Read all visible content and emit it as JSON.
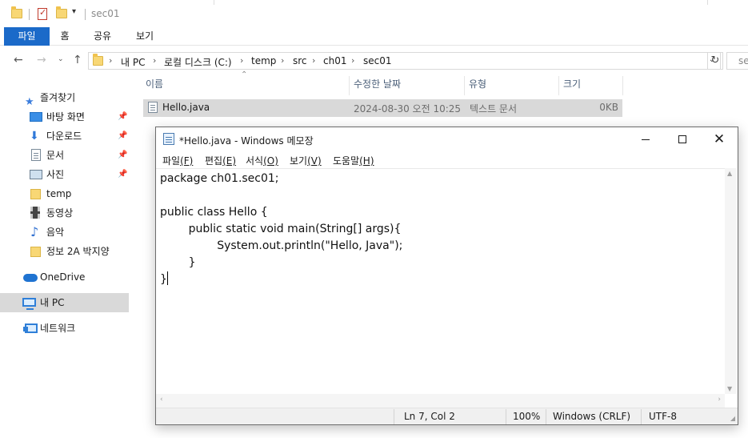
{
  "explorer": {
    "title": "sec01",
    "ribbon_tabs": [
      "파일",
      "홈",
      "공유",
      "보기"
    ],
    "breadcrumb": [
      "내 PC",
      "로컬 디스크 (C:)",
      "temp",
      "src",
      "ch01",
      "sec01"
    ],
    "search_placeholder": "se",
    "nav": {
      "quick_access": "즐겨찾기",
      "items": [
        "바탕 화면",
        "다운로드",
        "문서",
        "사진",
        "temp",
        "동영상",
        "음악",
        "정보 2A 박지양"
      ],
      "onedrive": "OneDrive",
      "this_pc": "내 PC",
      "network": "네트워크"
    },
    "columns": [
      "이름",
      "수정한 날짜",
      "유형",
      "크기"
    ],
    "files": [
      {
        "name": "Hello.java",
        "modified": "2024-08-30 오전 10:25",
        "type": "텍스트 문서",
        "size": "0KB"
      }
    ]
  },
  "notepad": {
    "title": "*Hello.java - Windows 메모장",
    "menu": [
      {
        "label": "파일",
        "key": "(F)"
      },
      {
        "label": "편집",
        "key": "(E)"
      },
      {
        "label": "서식",
        "key": "(O)"
      },
      {
        "label": "보기",
        "key": "(V)"
      },
      {
        "label": "도움말",
        "key": "(H)"
      }
    ],
    "content_lines": [
      "package ch01.sec01;",
      "",
      "public class Hello {",
      "\tpublic static void main(String[] args){",
      "\t\tSystem.out.println(\"Hello, Java\");",
      "\t}",
      "}"
    ],
    "status": {
      "position": "Ln 7, Col 2",
      "zoom": "100%",
      "line_ending": "Windows (CRLF)",
      "encoding": "UTF-8"
    }
  },
  "icons": {
    "folder": "folder-icon",
    "properties": "properties-icon",
    "quick_access": "star-icon",
    "desktop": "desktop-icon",
    "downloads": "download-icon",
    "documents": "document-icon",
    "pictures": "pictures-icon",
    "videos": "video-icon",
    "music": "music-icon",
    "onedrive": "cloud-icon",
    "pc": "computer-icon",
    "network": "network-icon",
    "text_file": "text-file-icon"
  },
  "colors": {
    "accent": "#1b6ac9",
    "selection": "#d9d9d9",
    "folder": "#f8d775"
  }
}
